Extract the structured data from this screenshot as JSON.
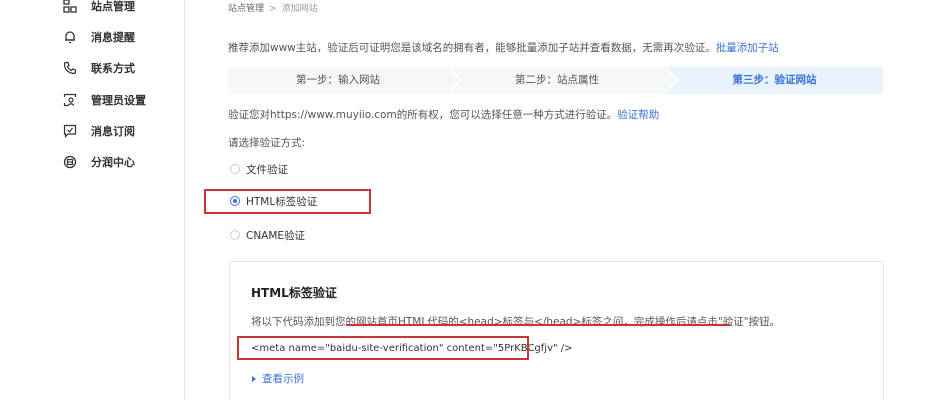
{
  "sidebar": {
    "items": [
      {
        "label": "站点管理",
        "icon": "site-icon"
      },
      {
        "label": "消息提醒",
        "icon": "bell-icon"
      },
      {
        "label": "联系方式",
        "icon": "phone-icon"
      },
      {
        "label": "管理员设置",
        "icon": "admin-icon"
      },
      {
        "label": "消息订阅",
        "icon": "subscribe-icon"
      },
      {
        "label": "分润中心",
        "icon": "revenue-icon"
      }
    ]
  },
  "breadcrumb": {
    "parent": "站点管理",
    "separator": ">",
    "current": "添加网站"
  },
  "intro": {
    "text": "推荐添加www主站，验证后可证明您是该域名的拥有者，能够批量添加子站并查看数据，无需再次验证。",
    "link": "批量添加子站"
  },
  "steps": [
    {
      "label": "第一步：输入网站"
    },
    {
      "label": "第二步：站点属性"
    },
    {
      "label": "第三步：验证网站"
    }
  ],
  "verify": {
    "text": "验证您对https://www.muyiio.com的所有权，您可以选择任意一种方式进行验证。",
    "help_link": "验证帮助",
    "method_label": "请选择验证方式:"
  },
  "methods": [
    {
      "label": "文件验证",
      "checked": false
    },
    {
      "label": "HTML标签验证",
      "checked": true
    },
    {
      "label": "CNAME验证",
      "checked": false
    }
  ],
  "panel": {
    "title": "HTML标签验证",
    "description": "将以下代码添加到您的网站首页HTML代码的<head>标签与</head>标签之间，完成操作后请点击\"验证\"按钮。",
    "code": "<meta name=\"baidu-site-verification\" content=\"5PrKBCgfjv\" />",
    "example_link": "查看示例"
  },
  "colors": {
    "accent": "#3a73d9",
    "highlight": "#c93535",
    "active_step_bg": "#e9f2fd"
  }
}
